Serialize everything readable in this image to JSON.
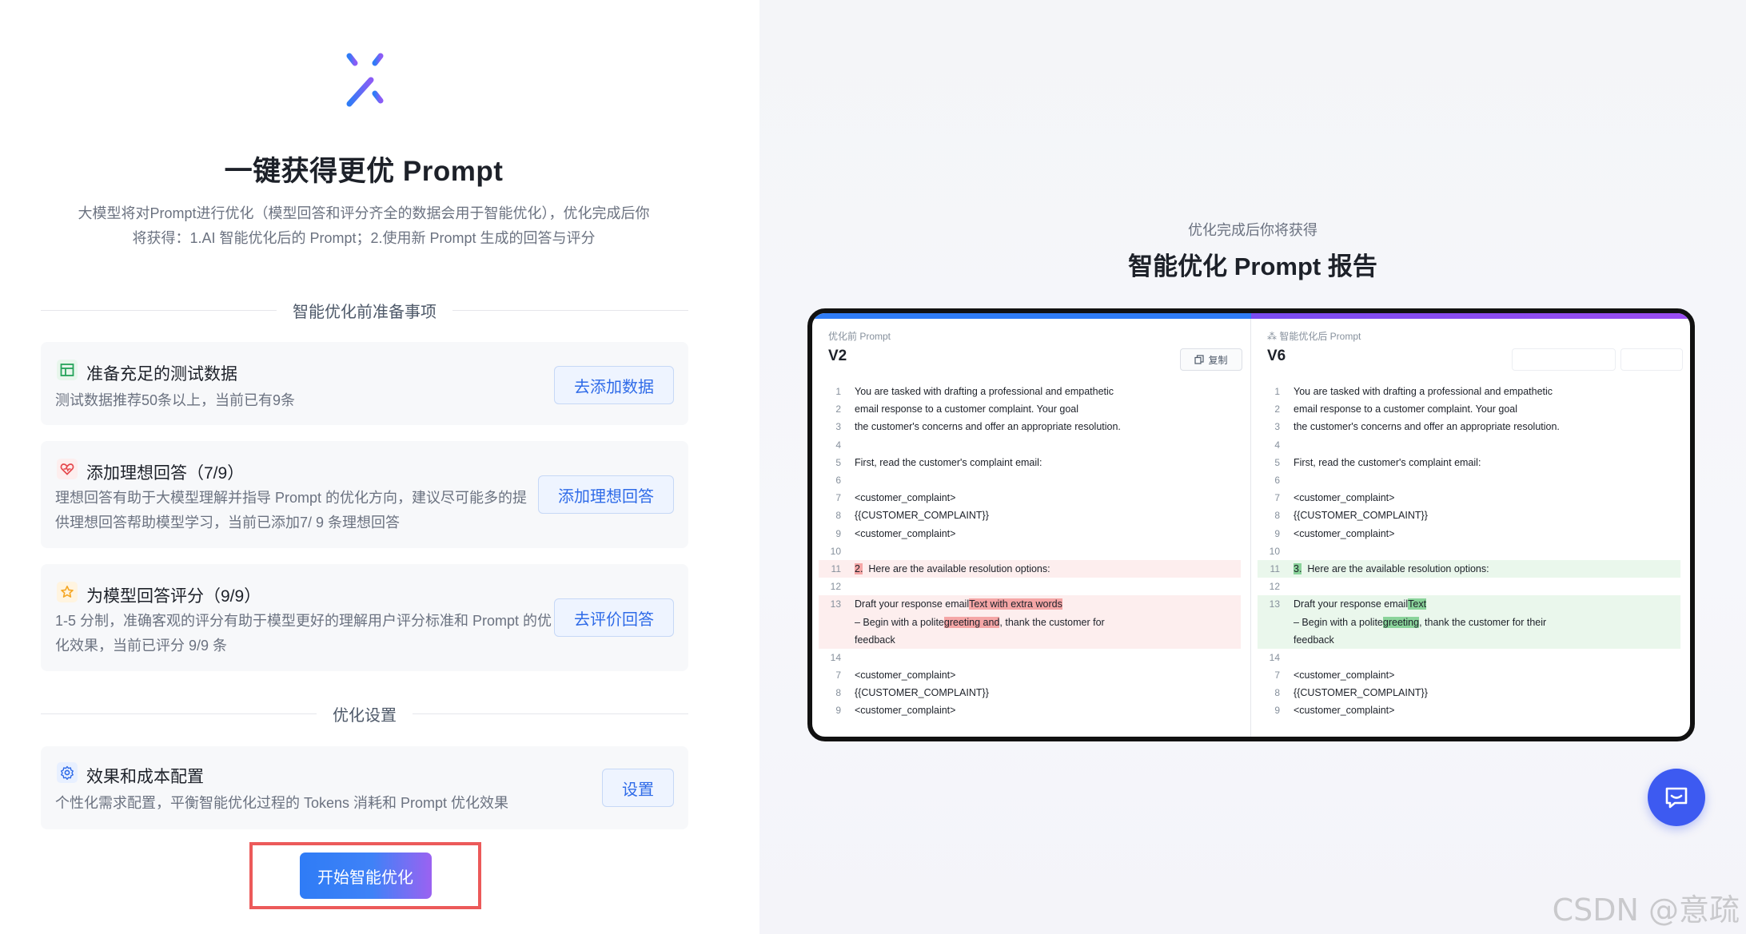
{
  "left": {
    "title": "一键获得更优 Prompt",
    "description_line1": "大模型将对Prompt进行优化（模型回答和评分齐全的数据会用于智能优化），优化完成后你",
    "description_line2": "将获得：1.AI 智能优化后的 Prompt；2.使用新 Prompt 生成的回答与评分",
    "section_prep": "智能优化前准备事项",
    "cards": [
      {
        "icon": "table-icon",
        "title": "准备充足的测试数据",
        "desc_line1": "测试数据推荐50条以上，当前已有9条",
        "desc_line2": "",
        "button": "去添加数据"
      },
      {
        "icon": "heart-icon",
        "title": "添加理想回答（7/9）",
        "desc_line1": "理想回答有助于大模型理解并指导 Prompt 的优化方向，建议尽可能多的提",
        "desc_line2": "供理想回答帮助模型学习，当前已添加7/ 9 条理想回答",
        "button": "添加理想回答"
      },
      {
        "icon": "star-icon",
        "title": "为模型回答评分（9/9）",
        "desc_line1": "1-5 分制，准确客观的评分有助于模型更好的理解用户评分标准和 Prompt 的优",
        "desc_line2": "化效果，当前已评分 9/9 条",
        "button": "去评价回答"
      }
    ],
    "section_settings": "优化设置",
    "settings_card": {
      "icon": "gear-icon",
      "title": "效果和成本配置",
      "desc": "个性化需求配置，平衡智能优化过程的 Tokens 消耗和 Prompt 优化效果",
      "button": "设置"
    },
    "start_button": "开始智能优化"
  },
  "right": {
    "subtitle": "优化完成后你将获得",
    "title": "智能优化 Prompt 报告",
    "before": {
      "label": "优化前 Prompt",
      "version": "V2",
      "copy_label": "复制",
      "rows": [
        {
          "n": "1",
          "parts": [
            {
              "t": "You are tasked with drafting a professional and empathetic"
            }
          ]
        },
        {
          "n": "2",
          "parts": [
            {
              "t": "email response to a customer complaint. Your goal"
            }
          ]
        },
        {
          "n": "3",
          "parts": [
            {
              "t": "the customer's concerns and offer an appropriate resolution."
            }
          ]
        },
        {
          "n": "4",
          "parts": [
            {
              "t": ""
            }
          ]
        },
        {
          "n": "5",
          "parts": [
            {
              "t": "First, read the customer's complaint email:"
            }
          ]
        },
        {
          "n": "6",
          "parts": [
            {
              "t": ""
            }
          ]
        },
        {
          "n": "7",
          "parts": [
            {
              "t": "<customer_complaint>"
            }
          ]
        },
        {
          "n": "8",
          "parts": [
            {
              "t": "{{CUSTOMER_COMPLAINT}}"
            }
          ]
        },
        {
          "n": "9",
          "parts": [
            {
              "t": "<customer_complaint>"
            }
          ]
        },
        {
          "n": "10",
          "parts": [
            {
              "t": ""
            }
          ]
        },
        {
          "n": "11",
          "kind": "del",
          "parts": [
            {
              "t": "2.",
              "hl": true
            },
            {
              "t": "  Here are the available resolution options:"
            }
          ]
        },
        {
          "n": "12",
          "parts": [
            {
              "t": ""
            }
          ]
        },
        {
          "n": "13",
          "kind": "del",
          "parts": [
            {
              "t": "Draft your response email"
            },
            {
              "t": "Text with extra words",
              "hl": true
            }
          ]
        },
        {
          "n": "",
          "kind": "del",
          "parts": [
            {
              "t": "– Begin with a polite"
            },
            {
              "t": "greeting and",
              "hl": true
            },
            {
              "t": ", thank the customer for"
            }
          ]
        },
        {
          "n": "",
          "kind": "del",
          "parts": [
            {
              "t": "feedback"
            }
          ]
        },
        {
          "n": "14",
          "parts": [
            {
              "t": ""
            }
          ]
        },
        {
          "n": "7",
          "parts": [
            {
              "t": "<customer_complaint>"
            }
          ]
        },
        {
          "n": "8",
          "parts": [
            {
              "t": "{{CUSTOMER_COMPLAINT}}"
            }
          ]
        },
        {
          "n": "9",
          "parts": [
            {
              "t": "<customer_complaint>"
            }
          ]
        }
      ]
    },
    "after": {
      "label": "智能优化后 Prompt",
      "version": "V6",
      "rows": [
        {
          "n": "1",
          "parts": [
            {
              "t": "You are tasked with drafting a professional and empathetic"
            }
          ]
        },
        {
          "n": "2",
          "parts": [
            {
              "t": "email response to a customer complaint. Your goal"
            }
          ]
        },
        {
          "n": "3",
          "parts": [
            {
              "t": "the customer's concerns and offer an appropriate resolution."
            }
          ]
        },
        {
          "n": "4",
          "parts": [
            {
              "t": ""
            }
          ]
        },
        {
          "n": "5",
          "parts": [
            {
              "t": "First, read the customer's complaint email:"
            }
          ]
        },
        {
          "n": "6",
          "parts": [
            {
              "t": ""
            }
          ]
        },
        {
          "n": "7",
          "parts": [
            {
              "t": "<customer_complaint>"
            }
          ]
        },
        {
          "n": "8",
          "parts": [
            {
              "t": "{{CUSTOMER_COMPLAINT}}"
            }
          ]
        },
        {
          "n": "9",
          "parts": [
            {
              "t": "<customer_complaint>"
            }
          ]
        },
        {
          "n": "10",
          "parts": [
            {
              "t": ""
            }
          ]
        },
        {
          "n": "11",
          "kind": "add",
          "parts": [
            {
              "t": "3.",
              "hl": true
            },
            {
              "t": "  Here are the available resolution options:"
            }
          ]
        },
        {
          "n": "12",
          "parts": [
            {
              "t": ""
            }
          ]
        },
        {
          "n": "13",
          "kind": "add",
          "parts": [
            {
              "t": "Draft your response email"
            },
            {
              "t": "Text",
              "hl": true
            }
          ]
        },
        {
          "n": "",
          "kind": "add",
          "parts": [
            {
              "t": "– Begin with a polite"
            },
            {
              "t": "greeting",
              "hl": true
            },
            {
              "t": ", thank the customer for their"
            }
          ]
        },
        {
          "n": "",
          "kind": "add",
          "parts": [
            {
              "t": "feedback"
            }
          ]
        },
        {
          "n": "14",
          "parts": [
            {
              "t": ""
            }
          ]
        },
        {
          "n": "7",
          "parts": [
            {
              "t": "<customer_complaint>"
            }
          ]
        },
        {
          "n": "8",
          "parts": [
            {
              "t": "{{CUSTOMER_COMPLAINT}}"
            }
          ]
        },
        {
          "n": "9",
          "parts": [
            {
              "t": "<customer_complaint>"
            }
          ]
        }
      ]
    },
    "chat_icon": "chat-icon"
  },
  "watermark": "CSDN @意疏",
  "colors": {
    "accent": "#2f6be8",
    "gradient_start": "#2f7cf6",
    "gradient_end": "#9b62f1",
    "highlight_border": "#ec5a5a",
    "del_bg": "#fdeeee",
    "add_bg": "#eaf7ec"
  }
}
